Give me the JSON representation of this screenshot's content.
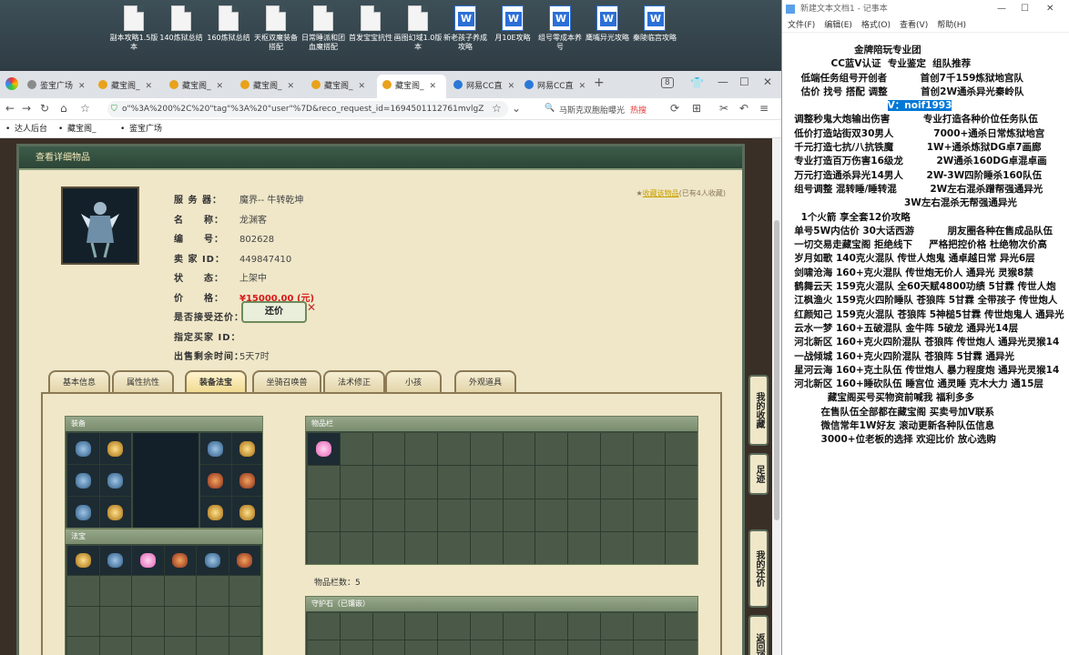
{
  "desktop": {
    "icons": [
      {
        "label": "副本攻略1.5版本",
        "type": "doc"
      },
      {
        "label": "140炼狱总结",
        "type": "doc"
      },
      {
        "label": "160炼狱总结",
        "type": "doc"
      },
      {
        "label": "天枢双魔装备搭配",
        "type": "doc"
      },
      {
        "label": "日常睡派和团血魔搭配",
        "type": "doc"
      },
      {
        "label": "首发宝宝抗性",
        "type": "doc"
      },
      {
        "label": "画图幻域1.0版本",
        "type": "doc"
      },
      {
        "label": "新老孩子养成攻略",
        "type": "word"
      },
      {
        "label": "月10E攻略",
        "type": "word"
      },
      {
        "label": "组号零成本养号",
        "type": "word"
      },
      {
        "label": "鹰嘴异光攻略",
        "type": "word"
      },
      {
        "label": "秦陵临宫攻略",
        "type": "word"
      }
    ]
  },
  "browser": {
    "tabs": [
      {
        "label": "鉴宝广场",
        "active": false
      },
      {
        "label": "藏宝阁_",
        "active": false
      },
      {
        "label": "藏宝阁_",
        "active": false
      },
      {
        "label": "藏宝阁_",
        "active": false
      },
      {
        "label": "藏宝阁_",
        "active": false
      },
      {
        "label": "藏宝阁_",
        "active": true
      },
      {
        "label": "网易CC直",
        "active": false
      },
      {
        "label": "网易CC直",
        "active": false
      }
    ],
    "tab_count": "8",
    "url": "o\"%3A%200%2C%20\"tag\"%3A%20\"user\"%7D&reco_request_id=1694501112761mvlgZ",
    "search_text": "马斯克双胞胎曝光",
    "hot_label": "热搜",
    "bookmarks": [
      "达人后台",
      "藏宝阁_",
      "鉴宝广场"
    ]
  },
  "panel": {
    "title": "查看详细物品",
    "fav_label": "收藏该物品",
    "fav_count": "(已有4人收藏)",
    "fields": [
      {
        "label": "服 务 器：",
        "value": "魔界-- 牛转乾坤"
      },
      {
        "label": "名　　称：",
        "value": "龙渊客"
      },
      {
        "label": "编　　号：",
        "value": "802628"
      },
      {
        "label": "卖 家 ID：",
        "value": "449847410"
      },
      {
        "label": "状　　态：",
        "value": "上架中"
      },
      {
        "label": "价　　格：",
        "value": "¥15000.00 (元)"
      },
      {
        "label": "是否接受还价：",
        "value": ""
      },
      {
        "label": "指定买家 ID：",
        "value": ""
      },
      {
        "label": "出售剩余时间：",
        "value": "5天7时"
      }
    ],
    "haggle_label": "还价",
    "tabs": [
      "基本信息",
      "属性抗性",
      "装备法宝",
      "坐骑召唤兽",
      "法术修正",
      "小孩",
      "外观道具"
    ],
    "active_tab": 2,
    "equip_title": "装备",
    "magic_title": "法宝",
    "bag_title": "物品栏",
    "bag_count": "物品栏数：5",
    "guard_title": "守护石（已镶嵌）",
    "side_buttons": [
      "我的收藏",
      "足迹",
      "我的还价",
      "返回顶部"
    ]
  },
  "notepad": {
    "title": "新建文本文档1 - 记事本",
    "menu": [
      "文件(F)",
      "编辑(E)",
      "格式(O)",
      "查看(V)",
      "帮助(H)"
    ],
    "lines": [
      "                    金牌陪玩专业团",
      "             CC蓝V认证  专业鉴定  组队推荐",
      "    低端任务组号开创者          首创7千159炼狱地宫队",
      "    估价 找号 搭配 调整          首创2W通杀异光秦岭队",
      "                              V：noif1993",
      "",
      "  调整秒鬼大炮输出伤害          专业打造各种价位任务队伍",
      "  低价打造站街双30男人            7000+通杀日常炼狱地宫",
      "  千元打造七抗/八抗铁魔          1W+通杀炼狱DG卓7画廊",
      "  专业打造百万伤害16级龙          2W通杀160DG卓混卓画",
      "  万元打造通杀异光14男人       2W-3W四阶睡杀160队伍",
      "  组号调整 混转睡/睡转混          2W左右混杀蹭帮强通异光",
      "                                   3W左右混杀无帮强通异光",
      "    1个火箭 享全套12价攻略",
      "  单号5W内估价 30大话西游          朋友圈各种在售成品队伍",
      "  一切交易走藏宝阁 拒绝线下     严格把控价格 杜绝物次价高",
      "",
      "",
      "  岁月如歌 140克火混队 传世人炮鬼 通卓越日常 异光6层",
      "  剑啸沧海 160+克火混队 传世炮无价人 通异光 灵猴8禁",
      "  鹤舞云天 159克火混队 全60天赋4800功绩 5甘霖 传世人炮",
      "  江枫渔火 159克火四阶睡队 苍狼阵 5甘霖 全带孩子 传世炮人",
      "  红颜知己 159克火混队 苍狼阵 5神槌5甘霖 传世炮鬼人 通异光",
      "  云水一梦 160+五破混队 金牛阵 5破龙 通异光14层",
      "  河北新区 160+克火四阶混队 苍狼阵 传世炮人 通异光灵猴14",
      "  一战倾城 160+克火四阶混队 苍狼阵 5甘霖 通异光",
      "  星河云海 160+克土队伍 传世炮人 暴力程度炮 通异光灵猴14",
      "  河北新区 160+睡砍队伍 睡宫位 通灵睡 克木大力 通15层",
      "",
      "            藏宝阁买号买物资前喊我 福利多多",
      "          在售队伍全部都在藏宝阁 买卖号加V联系",
      "          微信常年1W好友 滚动更新各种队伍信息",
      "          3000+位老板的选择 欢迎比价 放心选购"
    ],
    "highlight": "V：noif1993"
  }
}
